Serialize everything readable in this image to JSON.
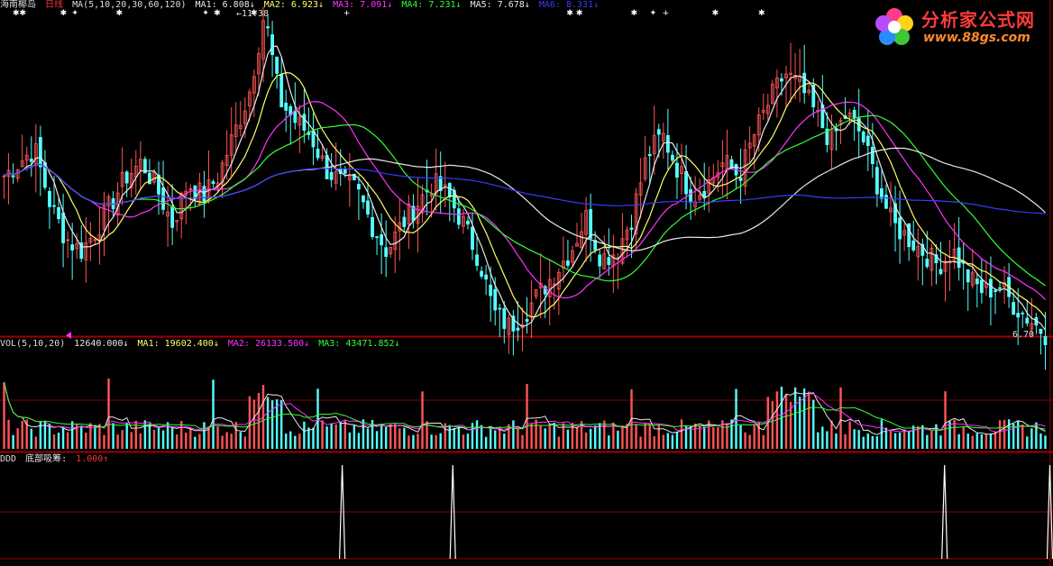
{
  "header": {
    "stock_name": "海南椰岛",
    "period": "日线",
    "ma_label": "MA(5,10,20,30,60,120)",
    "items": [
      {
        "text": "MA1: 6.808↓",
        "color": "#e8e8e8"
      },
      {
        "text": "MA2: 6.923↓",
        "color": "#ffff66"
      },
      {
        "text": "MA3: 7.091↓",
        "color": "#ff33ff"
      },
      {
        "text": "MA4: 7.231↓",
        "color": "#33ff33"
      },
      {
        "text": "MA5: 7.678↓",
        "color": "#e8e8e8"
      },
      {
        "text": "MA6: 8.331↓",
        "color": "#3a3aff"
      }
    ]
  },
  "volume_header": {
    "label": "VOL(5,10,20)",
    "items": [
      {
        "text": "12640.000↓",
        "color": "#e8e8e8"
      },
      {
        "text": "MA1: 19602.400↓",
        "color": "#ffff66"
      },
      {
        "text": "MA2: 26133.500↓",
        "color": "#ff33ff"
      },
      {
        "text": "MA3: 43471.852↓",
        "color": "#33ff33"
      }
    ]
  },
  "indicator_header": {
    "label": "DDD",
    "name": "底部吸筹:",
    "value": "1.000↑"
  },
  "high_label": "←11.38",
  "low_label": "6.70",
  "logo": {
    "title": "分析家公式网",
    "url": "www.88gs.com"
  },
  "colors": {
    "up": "#ff5555",
    "down": "#55ffff",
    "grid": "#8b0000",
    "ma_white": "#e8e8e8",
    "ma_magenta": "#ff33ff",
    "ma_green": "#33ff33",
    "ma_blue": "#3a3aff"
  },
  "chart_data": {
    "type": "line",
    "price_axis": {
      "high": 11.38,
      "low": 6.7
    },
    "price_path": [
      9.0,
      9.2,
      9.4,
      8.6,
      8.1,
      7.9,
      8.2,
      8.6,
      9.0,
      9.2,
      8.8,
      8.3,
      8.9,
      8.7,
      9.0,
      9.6,
      10.2,
      11.38,
      10.1,
      9.8,
      9.6,
      9.1,
      8.9,
      8.8,
      8.3,
      7.9,
      8.3,
      8.6,
      8.9,
      8.7,
      8.3,
      7.8,
      7.0,
      6.8,
      7.0,
      7.3,
      7.6,
      7.9,
      8.4,
      7.8,
      7.9,
      8.4,
      9.3,
      9.6,
      9.1,
      8.7,
      8.9,
      9.2,
      9.0,
      9.6,
      10.1,
      10.5,
      10.3,
      9.9,
      9.5,
      9.9,
      9.6,
      8.9,
      8.3,
      8.1,
      7.9,
      7.7,
      7.9,
      7.5,
      7.3,
      7.4,
      7.1,
      6.9,
      6.7
    ],
    "markers": {
      "top_symbols": [
        {
          "x_frac": 0.012,
          "symbol": "✱✱"
        },
        {
          "x_frac": 0.057,
          "symbol": "✱"
        },
        {
          "x_frac": 0.068,
          "symbol": "✦"
        },
        {
          "x_frac": 0.11,
          "symbol": "✱"
        },
        {
          "x_frac": 0.192,
          "symbol": "✦"
        },
        {
          "x_frac": 0.203,
          "symbol": "✱"
        },
        {
          "x_frac": 0.238,
          "symbol": "✱"
        },
        {
          "x_frac": 0.326,
          "symbol": "+"
        },
        {
          "x_frac": 0.538,
          "symbol": "✱"
        },
        {
          "x_frac": 0.547,
          "symbol": "✱"
        },
        {
          "x_frac": 0.599,
          "symbol": "✱"
        },
        {
          "x_frac": 0.617,
          "symbol": "✦"
        },
        {
          "x_frac": 0.629,
          "symbol": "+"
        },
        {
          "x_frac": 0.676,
          "symbol": "✱"
        },
        {
          "x_frac": 0.72,
          "symbol": "✱"
        }
      ]
    },
    "indicator_signals": [
      0.325,
      0.43,
      0.897,
      0.997
    ]
  }
}
